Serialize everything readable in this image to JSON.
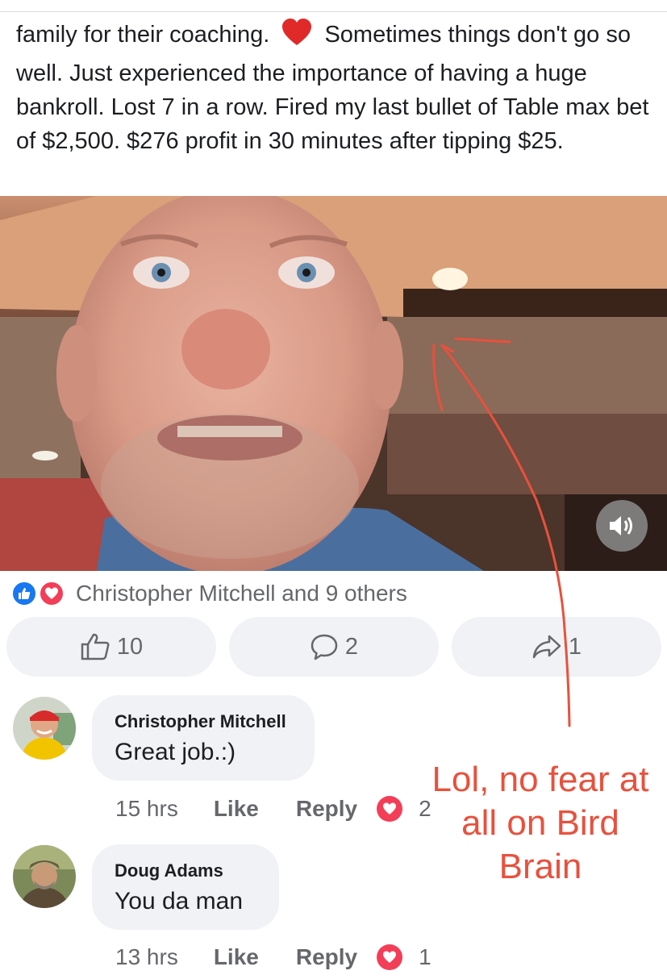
{
  "post": {
    "text_before_emoji": "family for their coaching.",
    "emoji": "heart-emoji",
    "text_after_emoji": "Sometimes things don't go so well. Just experienced the importance of having a huge bankroll. Lost 7 in a row. Fired my last bullet of Table max bet of $2,500. $276 profit in 30 minutes after tipping $25."
  },
  "video": {
    "sound_icon": "speaker-volume-icon"
  },
  "reactions": {
    "text": "Christopher Mitchell and 9 others",
    "icons": [
      "like-reaction-icon",
      "love-reaction-icon"
    ]
  },
  "actions": {
    "like_count": "10",
    "comment_count": "2",
    "share_count": "1"
  },
  "comments": [
    {
      "name": "Christopher Mitchell",
      "text": "Great job.:)",
      "time": "15 hrs",
      "like_label": "Like",
      "reply_label": "Reply",
      "reaction_count": "2"
    },
    {
      "name": "Doug Adams",
      "text": "You da man",
      "time": "13 hrs",
      "like_label": "Like",
      "reply_label": "Reply",
      "reaction_count": "1"
    }
  ],
  "annotation": {
    "text": "Lol, no fear at all on Bird Brain",
    "color": "#e8513d"
  },
  "colors": {
    "like_blue": "#1877f2",
    "love_red": "#f33e58",
    "meta_gray": "#65676b",
    "bubble_bg": "#f0f2f5"
  }
}
